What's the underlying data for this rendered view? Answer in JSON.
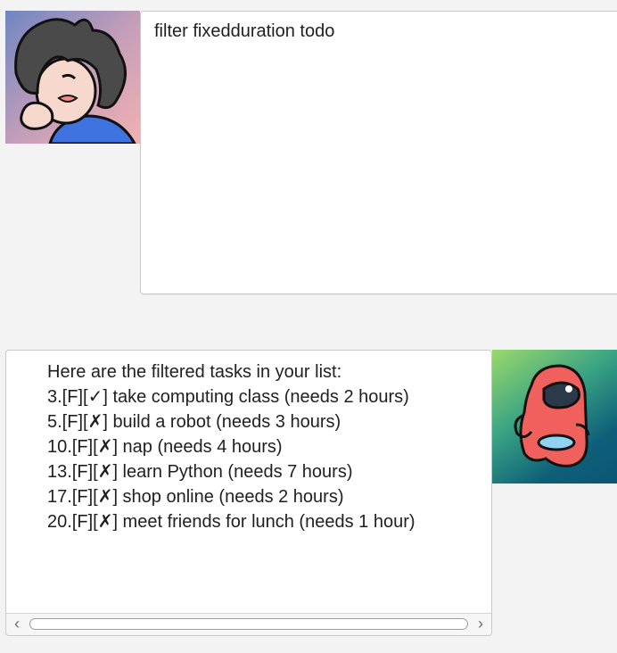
{
  "user_message": {
    "text": "filter fixedduration todo",
    "avatar_icon": "user-avatar-icon"
  },
  "duke_message": {
    "lines": [
      "Here are the filtered tasks in your list:",
      "3.[F][✓] take computing class (needs 2 hours)",
      "5.[F][✗] build a robot (needs 3 hours)",
      "10.[F][✗] nap (needs 4 hours)",
      "13.[F][✗] learn Python (needs 7 hours)",
      "17.[F][✗] shop online (needs 2 hours)",
      "20.[F][✗] meet friends for lunch (needs 1 hour)"
    ],
    "avatar_icon": "bot-avatar-icon"
  },
  "scrollbar": {
    "left_arrow": "‹",
    "right_arrow": "›"
  }
}
